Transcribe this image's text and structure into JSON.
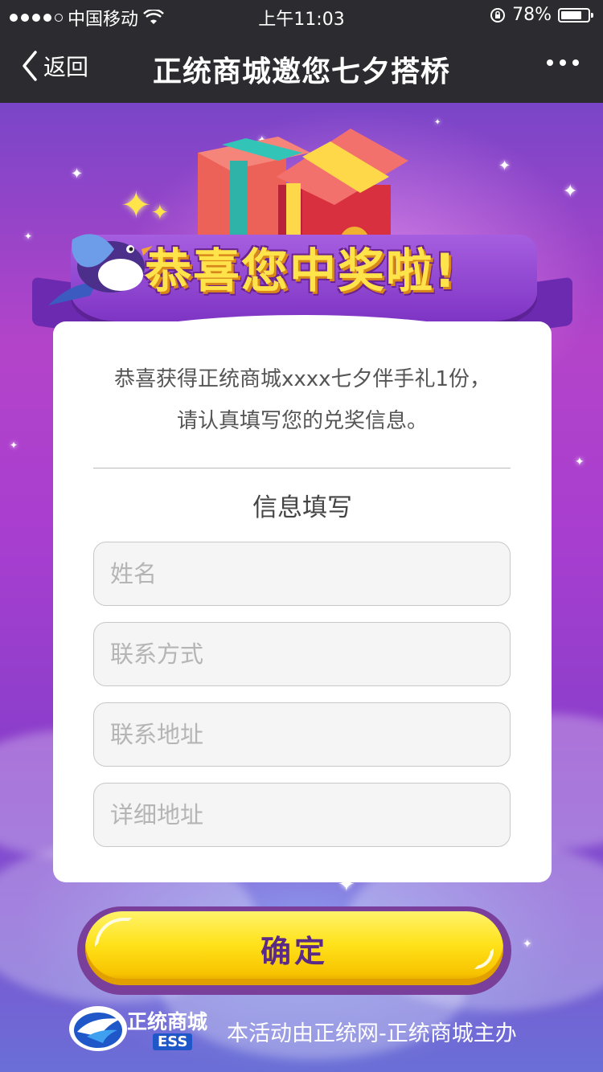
{
  "status_bar": {
    "carrier": "中国移动",
    "time": "上午11:03",
    "battery_text": "78%",
    "battery_level": 0.78
  },
  "nav": {
    "back_label": "返回",
    "title": "正统商城邀您七夕搭桥"
  },
  "banner": {
    "headline": "恭喜您中奖啦!"
  },
  "card": {
    "message_line1": "恭喜获得正统商城xxxx七夕伴手礼1份，",
    "message_line2": "请认真填写您的兑奖信息。",
    "form_title": "信息填写",
    "fields": {
      "name_placeholder": "姓名",
      "contact_placeholder": "联系方式",
      "address_placeholder": "联系地址",
      "detail_address_placeholder": "详细地址"
    }
  },
  "confirm_label": "确定",
  "footer": {
    "brand": "正统商城",
    "brand_sub": "ESS",
    "organizer_text": "本活动由正统网-正统商城主办"
  },
  "colors": {
    "nav_bg": "#2c2c30",
    "button_yellow": "#ffe21a",
    "button_text": "#5a2a86",
    "banner_purple": "#8a42d0"
  }
}
